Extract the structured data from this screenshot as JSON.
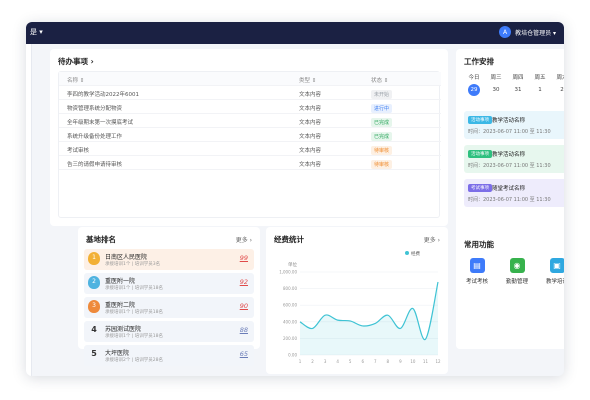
{
  "topbar": {
    "menu": "是 ▾",
    "user_initial": "A",
    "user_name": "教培仓管理员 ▾"
  },
  "todo": {
    "title": "待办事项 ›",
    "headers": [
      "名称 ⇕",
      "类型 ⇕",
      "状态 ⇕"
    ],
    "rows": [
      {
        "name": "李四的教学活动2022年6001",
        "type": "文本内容",
        "status": "未开始",
        "color": "#9aa0a8",
        "bg": "#f0f1f3"
      },
      {
        "name": "物资管理系统分配物资",
        "type": "文本内容",
        "status": "进行中",
        "color": "#3b7cf0",
        "bg": "#e8f0fe"
      },
      {
        "name": "全年级期末第一次摸底考试",
        "type": "文本内容",
        "status": "已完成",
        "color": "#2ea85e",
        "bg": "#e6f6ec"
      },
      {
        "name": "系统升级备份处理工作",
        "type": "文本内容",
        "status": "已完成",
        "color": "#2ea85e",
        "bg": "#e6f6ec"
      },
      {
        "name": "考试审核",
        "type": "文本内容",
        "status": "待审核",
        "color": "#f08c2e",
        "bg": "#fdf0e3"
      },
      {
        "name": "告三的请假申请待审核",
        "type": "文本内容",
        "status": "待审核",
        "color": "#f08c2e",
        "bg": "#fdf0e3"
      }
    ]
  },
  "schedule": {
    "title": "工作安排",
    "days": [
      {
        "label": "今日",
        "num": "29",
        "active": true
      },
      {
        "label": "周三",
        "num": "30",
        "active": false
      },
      {
        "label": "周四",
        "num": "31",
        "active": false
      },
      {
        "label": "周五",
        "num": "1",
        "active": false
      },
      {
        "label": "周六",
        "num": "2",
        "active": false
      }
    ],
    "events": [
      {
        "tag": "活动事项",
        "title": "教学活动名称",
        "time": "时间：2023-06-07 11:00 至 11:30",
        "tagColor": "#3bb8e6",
        "bg": "#e9f6fc"
      },
      {
        "tag": "活动事项",
        "title": "教学活动名称",
        "time": "时间：2023-06-07 11:00 至 11:30",
        "tagColor": "#2ec07f",
        "bg": "#e7f7ee"
      },
      {
        "tag": "考试事项",
        "title": "随堂考试名称",
        "time": "时间：2023-06-07 11:00 至 11:30",
        "tagColor": "#7c6ee8",
        "bg": "#eeecfc"
      }
    ]
  },
  "functions": {
    "title": "常用功能",
    "items": [
      {
        "label": "考试考核",
        "icon": "exam-icon",
        "glyph": "▤",
        "color": "#3e7bfa"
      },
      {
        "label": "勤勤管理",
        "icon": "attendance-icon",
        "glyph": "◉",
        "color": "#37b24d"
      },
      {
        "label": "教学培训",
        "icon": "training-icon",
        "glyph": "▣",
        "color": "#2fa8e0"
      }
    ]
  },
  "rank": {
    "title": "基地排名",
    "more": "更多 ›",
    "items": [
      {
        "pos": "1",
        "name": "日南区人民医院",
        "sub": "承接培训1个 | 培训学员3名",
        "score": "99",
        "scoreColor": "#e04a4a",
        "bg": "#fdf0e6",
        "medal": "#f2b035"
      },
      {
        "pos": "2",
        "name": "重医附一院",
        "sub": "承接培训1个 | 培训学员18名",
        "score": "92",
        "scoreColor": "#e04a4a",
        "bg": "#f2f5fa",
        "medal": "#4fb3e0"
      },
      {
        "pos": "3",
        "name": "重医附二院",
        "sub": "承接培训1个 | 培训学员18名",
        "score": "90",
        "scoreColor": "#e04a4a",
        "bg": "#f2f5fa",
        "medal": "#ee8a3c"
      },
      {
        "pos": "4",
        "name": "苏园测试医院",
        "sub": "承接培训1个 | 培训学员18名",
        "score": "88",
        "scoreColor": "#6b7db8",
        "bg": "#f2f5fa",
        "medal": ""
      },
      {
        "pos": "5",
        "name": "大坪医院",
        "sub": "承接培训2个 | 培训学员28名",
        "score": "65",
        "scoreColor": "#6b7db8",
        "bg": "#f2f5fa",
        "medal": ""
      }
    ]
  },
  "chart_data": {
    "type": "area",
    "title": "经费统计",
    "more": "更多 ›",
    "ylabel": "单位",
    "legend": "经费",
    "legend_position": "top-right",
    "color": "#3fc3d4",
    "x": [
      "1",
      "2",
      "3",
      "4",
      "5",
      "6",
      "7",
      "8",
      "9",
      "10",
      "11",
      "12"
    ],
    "values": [
      400,
      320,
      480,
      420,
      410,
      350,
      380,
      480,
      320,
      560,
      190,
      880
    ],
    "ylim": [
      0,
      1000
    ],
    "yticks": [
      "1,000.00",
      "800.00",
      "600.00",
      "400.00",
      "200.00",
      "0.00"
    ],
    "grid": true
  }
}
